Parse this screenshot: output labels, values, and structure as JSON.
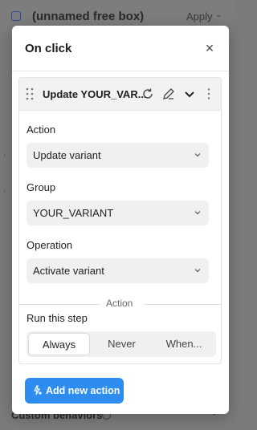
{
  "background": {
    "box_title": "(unnamed free box)",
    "apply_label": "Apply",
    "custom_behaviors_label": "Custom behaviors",
    "plus_icon": "+"
  },
  "modal": {
    "title": "On click",
    "close_icon": "×"
  },
  "step": {
    "name": "Update YOUR_VAR...",
    "fields": {
      "action_label": "Action",
      "action_value": "Update variant",
      "group_label": "Group",
      "group_value": "YOUR_VARIANT",
      "operation_label": "Operation",
      "operation_value": "Activate variant"
    },
    "divider_label": "Action",
    "run_label": "Run this step",
    "run_options": [
      "Always",
      "Never",
      "When..."
    ],
    "run_selected": "Always"
  },
  "add_button_label": "Add new action",
  "colors": {
    "accent": "#2d8cf0",
    "overlay": "#7b7b7b"
  }
}
